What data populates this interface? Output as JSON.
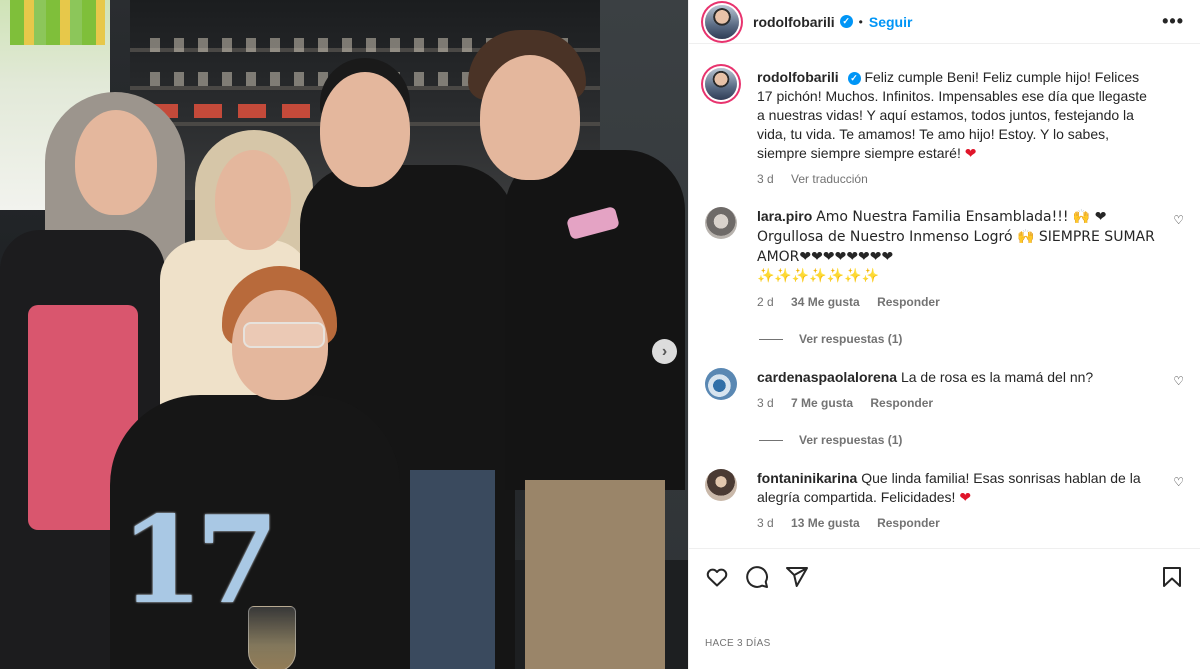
{
  "post": {
    "username": "rodolfobarili",
    "follow_label": "Seguir",
    "more_label": "•••",
    "separator": "•"
  },
  "photo": {
    "cake_number": "17",
    "next_icon": "›"
  },
  "caption": {
    "username": "rodolfobarili",
    "text": "Feliz cumple Beni! Feliz cumple hijo! Felices 17 pichón! Muchos. Infinitos. Impensables ese día que llegaste a nuestras vidas! Y aquí estamos, todos juntos, festejando la vida, tu vida. Te amamos! Te amo hijo! Estoy. Y lo sabes, siempre siempre siempre estaré!",
    "heart": "❤",
    "time": "3 d",
    "translate_label": "Ver traducción"
  },
  "comments": [
    {
      "username": "lara.piro",
      "text": "Amo Nuestra Familia Ensamblada!!! 🙌 ❤ Orgullosa de Nuestro Inmenso Logró 🙌 SIEMPRE SUMAR AMOR❤❤❤❤❤❤❤❤",
      "sparkles": "✨✨✨✨✨✨✨",
      "time": "2 d",
      "likes": "34 Me gusta",
      "reply_label": "Responder",
      "view_replies": "Ver respuestas (1)"
    },
    {
      "username": "cardenaspaolalorena",
      "text": "La de rosa es la mamá del nn?",
      "time": "3 d",
      "likes": "7 Me gusta",
      "reply_label": "Responder",
      "view_replies": "Ver respuestas (1)"
    },
    {
      "username": "fontaninikarina",
      "text": "Que linda familia! Esas sonrisas hablan de la alegría compartida. Felicidades!",
      "heart": "❤",
      "time": "3 d",
      "likes": "13 Me gusta",
      "reply_label": "Responder"
    }
  ],
  "icons": {
    "like_small": "♡",
    "verified": "✓"
  },
  "footer": {
    "timestamp": "HACE 3 DÍAS"
  },
  "colors": {
    "accent": "#0095f6",
    "heart": "#e0152a",
    "muted": "#737373"
  }
}
